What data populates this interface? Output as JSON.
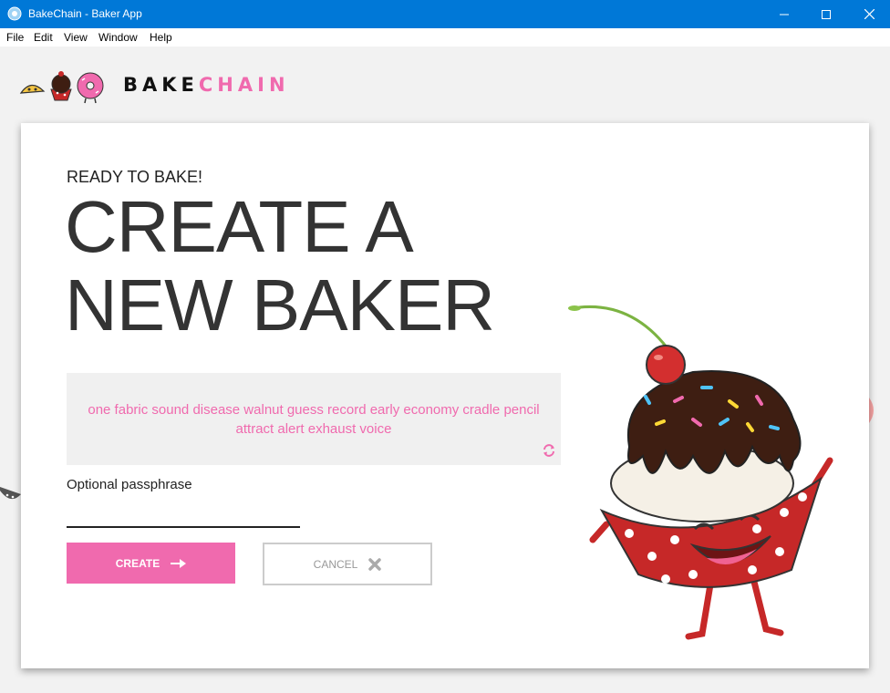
{
  "window": {
    "title": "BakeChain - Baker App"
  },
  "menu": [
    "File",
    "Edit",
    "View",
    "Window",
    "Help"
  ],
  "brand": {
    "part1": "BAKE",
    "part2": "CHAIN"
  },
  "form": {
    "subtitle": "READY TO BAKE!",
    "headline_line1": "CREATE A",
    "headline_line2": "NEW BAKER",
    "mnemonic": "one fabric sound disease walnut guess record early economy cradle pencil attract alert exhaust voice",
    "passphrase_label": "Optional passphrase",
    "passphrase_value": "",
    "create_label": "CREATE",
    "cancel_label": "CANCEL"
  },
  "colors": {
    "titlebar": "#0078d7",
    "accent": "#f06aae",
    "text": "#333333"
  },
  "icons": [
    "app-icon",
    "minimize-icon",
    "maximize-icon",
    "close-icon",
    "refresh-icon",
    "arrow-right-icon",
    "x-icon",
    "cupcake-mascot-illustration"
  ]
}
